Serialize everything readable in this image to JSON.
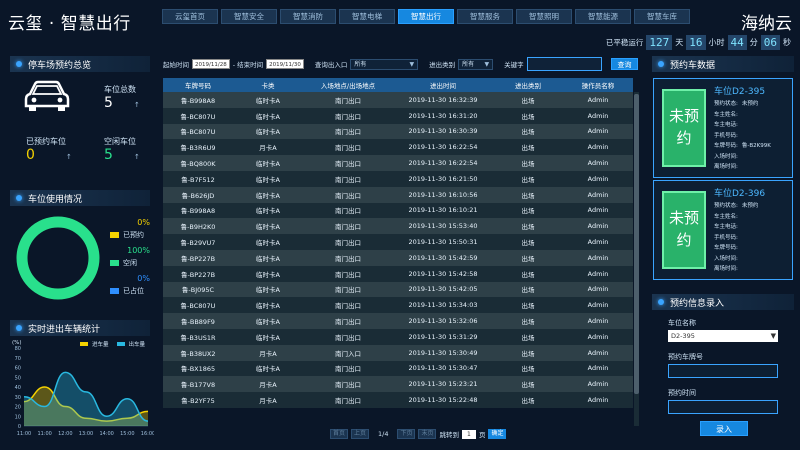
{
  "header": {
    "brand": "云玺 · 智慧出行",
    "brand_right": "海纳云",
    "tabs": [
      "云玺首页",
      "智慧安全",
      "智慧消防",
      "智慧电梯",
      "智慧出行",
      "智慧服务",
      "智慧照明",
      "智慧能源",
      "智慧车库"
    ],
    "active_tab": 4,
    "uptime": {
      "label": "已平稳运行",
      "days": "127",
      "day_unit": "天",
      "hours": "16",
      "hour_unit": "小时",
      "minutes": "44",
      "minute_unit": "分",
      "seconds": "06",
      "second_unit": "秒"
    }
  },
  "left": {
    "reservation_overview": {
      "title": "停车场预约总览",
      "total_label": "车位总数",
      "total_value": "5",
      "reserved_label": "已预约车位",
      "reserved_value": "0",
      "free_label": "空闲车位",
      "free_value": "5",
      "arrow": "↑"
    },
    "usage": {
      "title": "车位使用情况",
      "legend": [
        {
          "pct": "0%",
          "label": "已预约",
          "color": "#f5d200"
        },
        {
          "pct": "100%",
          "label": "空闲",
          "color": "#29e08c"
        },
        {
          "pct": "0%",
          "label": "已占位",
          "color": "#2f8fff"
        }
      ]
    },
    "realtime": {
      "title": "实时进出车辆统计",
      "ylabel": "(%)",
      "legend_in": "进车量",
      "legend_out": "出车量"
    }
  },
  "filters": {
    "start_label": "起始时间",
    "start_value": "2019/11/28",
    "end_label": "- 结束时间",
    "end_value": "2019/11/30",
    "gate_label": "查询出入口",
    "gate_value": "所有",
    "type_label": "进出类别",
    "type_value": "所有",
    "keyword_label": "关键字",
    "query_button": "查询"
  },
  "table": {
    "headers": [
      "车牌号码",
      "卡类",
      "入场地点/出场地点",
      "进出时间",
      "进出类别",
      "操作员名称"
    ],
    "rows": [
      [
        "鲁-B998A8",
        "临时卡A",
        "南门出口",
        "2019-11-30 16:32:39",
        "出场",
        "Admin"
      ],
      [
        "鲁-BC807U",
        "临时卡A",
        "南门出口",
        "2019-11-30 16:31:20",
        "出场",
        "Admin"
      ],
      [
        "鲁-BC807U",
        "临时卡A",
        "南门出口",
        "2019-11-30 16:30:39",
        "出场",
        "Admin"
      ],
      [
        "鲁-B3R6U9",
        "月卡A",
        "南门出口",
        "2019-11-30 16:22:54",
        "出场",
        "Admin"
      ],
      [
        "鲁-BQ800K",
        "临时卡A",
        "南门出口",
        "2019-11-30 16:22:54",
        "出场",
        "Admin"
      ],
      [
        "鲁-B7F512",
        "临时卡A",
        "南门出口",
        "2019-11-30 16:21:50",
        "出场",
        "Admin"
      ],
      [
        "鲁-B626JD",
        "临时卡A",
        "南门出口",
        "2019-11-30 16:10:56",
        "出场",
        "Admin"
      ],
      [
        "鲁-B998A8",
        "临时卡A",
        "南门出口",
        "2019-11-30 16:10:21",
        "出场",
        "Admin"
      ],
      [
        "鲁-B9H2K0",
        "临时卡A",
        "南门出口",
        "2019-11-30 15:53:40",
        "出场",
        "Admin"
      ],
      [
        "鲁-B29VU7",
        "临时卡A",
        "南门出口",
        "2019-11-30 15:50:31",
        "出场",
        "Admin"
      ],
      [
        "鲁-BP227B",
        "临时卡A",
        "南门出口",
        "2019-11-30 15:42:59",
        "出场",
        "Admin"
      ],
      [
        "鲁-BP227B",
        "临时卡A",
        "南门出口",
        "2019-11-30 15:42:58",
        "出场",
        "Admin"
      ],
      [
        "鲁-BJ095C",
        "临时卡A",
        "南门出口",
        "2019-11-30 15:42:05",
        "出场",
        "Admin"
      ],
      [
        "鲁-BC807U",
        "临时卡A",
        "南门出口",
        "2019-11-30 15:34:03",
        "出场",
        "Admin"
      ],
      [
        "鲁-BB89F9",
        "临时卡A",
        "南门出口",
        "2019-11-30 15:32:06",
        "出场",
        "Admin"
      ],
      [
        "鲁-B3US1R",
        "临时卡A",
        "南门出口",
        "2019-11-30 15:31:29",
        "出场",
        "Admin"
      ],
      [
        "鲁-B38UX2",
        "月卡A",
        "南门入口",
        "2019-11-30 15:30:49",
        "出场",
        "Admin"
      ],
      [
        "鲁-BX1865",
        "临时卡A",
        "南门出口",
        "2019-11-30 15:30:47",
        "出场",
        "Admin"
      ],
      [
        "鲁-B177V8",
        "月卡A",
        "南门出口",
        "2019-11-30 15:23:21",
        "出场",
        "Admin"
      ],
      [
        "鲁-B2YF75",
        "月卡A",
        "南门出口",
        "2019-11-30 15:22:48",
        "出场",
        "Admin"
      ]
    ]
  },
  "pager": {
    "page": "1/4",
    "goto_label": "跳转到",
    "goto_value": "1",
    "page_unit": "页",
    "go": "确定",
    "first": "首页",
    "prev": "上页",
    "next": "下页",
    "last": "末页"
  },
  "right": {
    "reservation_data_title": "预约车数据",
    "cards": [
      {
        "slot_text": "未预约",
        "title": "车位D2-395",
        "fields": [
          "预约状态:",
          "车主姓名:",
          "车主电话:",
          "手机号码:",
          "车牌号码:",
          "入场时间:",
          "离场时间:"
        ],
        "values": [
          "未预约",
          "",
          "",
          "",
          "鲁-B2K99K",
          "",
          ""
        ]
      },
      {
        "slot_text": "未预约",
        "title": "车位D2-396",
        "fields": [
          "预约状态:",
          "车主姓名:",
          "车主电话:",
          "手机号码:",
          "车牌号码:",
          "入场时间:",
          "离场时间:"
        ],
        "values": [
          "未预约",
          "",
          "",
          "",
          "",
          "",
          ""
        ]
      }
    ],
    "form": {
      "title": "预约信息录入",
      "slot_label": "车位名称",
      "slot_value": "D2-395",
      "plate_label": "预约车牌号",
      "time_label": "预约时间",
      "submit": "录入"
    }
  },
  "chart_data": {
    "type": "area",
    "x": [
      "11:00",
      "11:00",
      "12:00",
      "13:00",
      "14:00",
      "15:00",
      "16:00"
    ],
    "ylabel": "(%)",
    "yticks": [
      0,
      10,
      20,
      30,
      40,
      50,
      60,
      70,
      80
    ],
    "ylim": [
      0,
      80
    ],
    "series": [
      {
        "name": "进车量",
        "color": "#f5d200",
        "values": [
          25,
          40,
          20,
          8,
          5,
          8,
          15
        ]
      },
      {
        "name": "出车量",
        "color": "#29b8e0",
        "values": [
          30,
          20,
          55,
          35,
          10,
          28,
          5
        ]
      }
    ],
    "legend": "top-right",
    "grid": false
  }
}
